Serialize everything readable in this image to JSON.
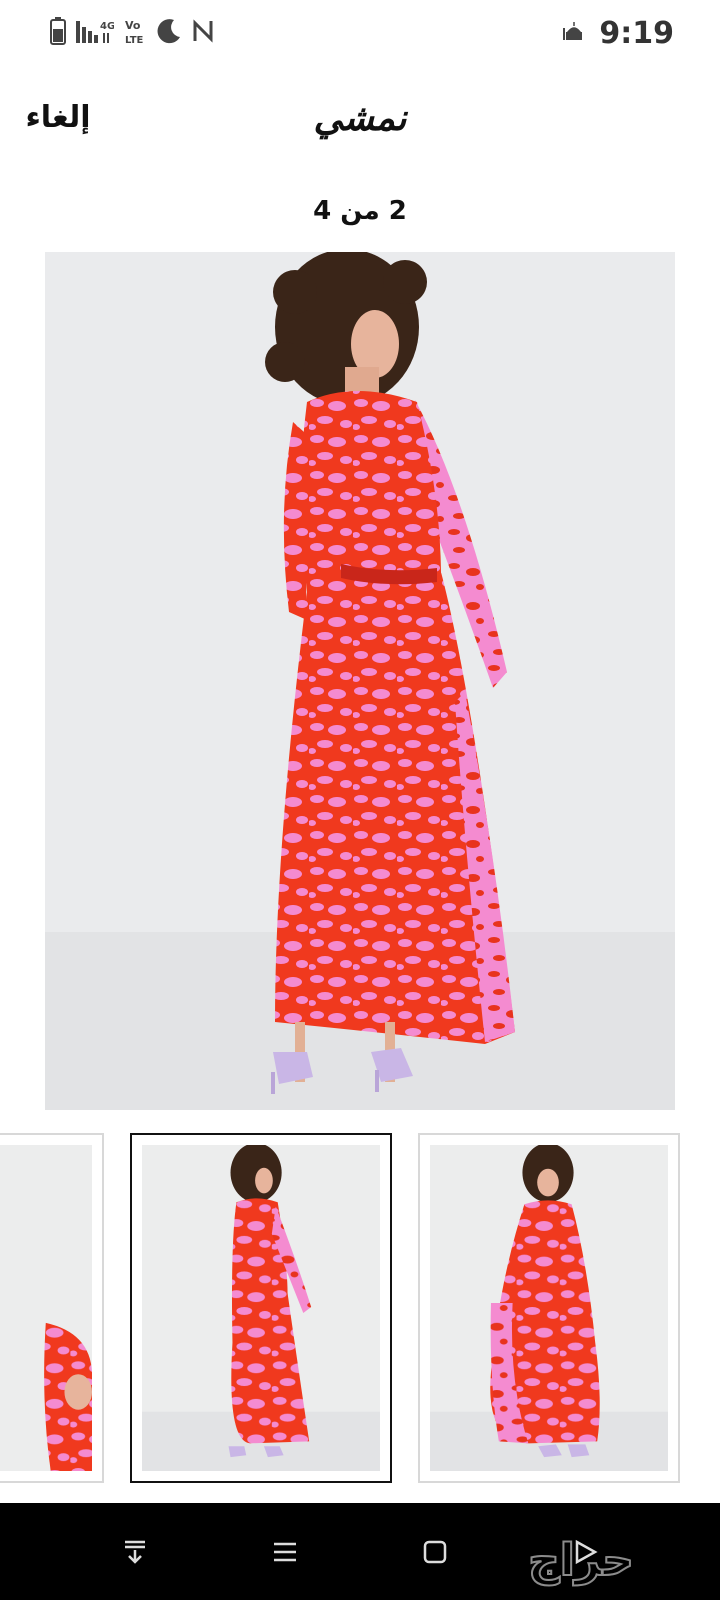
{
  "status_bar": {
    "time": "9:19",
    "network_label": "4G",
    "volte_label": "Vo LTE"
  },
  "header": {
    "brand_logo_text": "نمشي",
    "cancel_label": "إلغاء"
  },
  "gallery": {
    "counter_text": "2 من 4",
    "selected_index": 2,
    "total": 4
  },
  "product": {
    "dress_colors": {
      "base": "#f0391e",
      "pattern": "#f48bd0",
      "background": "#eaebed",
      "shoes": "#c9b6e6",
      "hair": "#3a2518"
    }
  },
  "colors": {
    "nav_bar": "#000000",
    "selected_border": "#111111",
    "thumb_border": "#d8d8d8"
  },
  "watermark": {
    "text": "حراج"
  },
  "icons": {
    "battery": "battery-icon",
    "signal": "signal-icon",
    "moon": "moon-icon",
    "nfc": "nfc-icon",
    "mosque": "mosque-icon",
    "nav_down": "keyboard-down-icon",
    "nav_menu": "menu-icon",
    "nav_home": "home-icon",
    "nav_back": "back-icon"
  }
}
